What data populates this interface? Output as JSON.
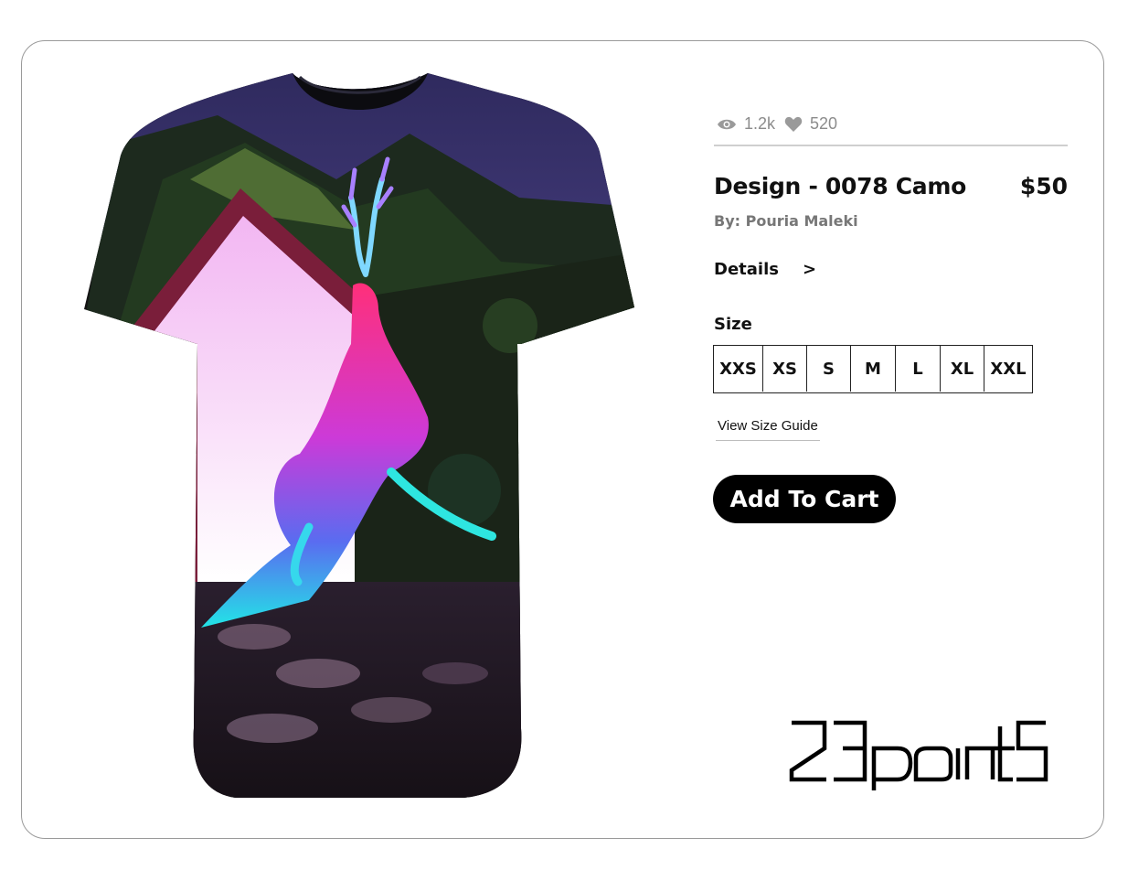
{
  "stats": {
    "views": "1.2k",
    "likes": "520"
  },
  "product": {
    "title": "Design - 0078 Camo",
    "price": "$50",
    "author": "By: Pouria Maleki"
  },
  "details": {
    "label": "Details",
    "arrow": ">"
  },
  "size": {
    "label": "Size",
    "options": [
      "XXS",
      "XS",
      "S",
      "M",
      "L",
      "XL",
      "XXL"
    ],
    "guide_label": "View Size Guide"
  },
  "cart": {
    "label": "Add To Cart"
  },
  "brand": {
    "logo_text": "23point5"
  },
  "icons": {
    "views": "eye-icon",
    "likes": "heart-icon",
    "details": "chevron-right-icon"
  },
  "colors": {
    "accent": "#000000",
    "muted": "#8c8c8c",
    "border": "#9a9a9a"
  }
}
